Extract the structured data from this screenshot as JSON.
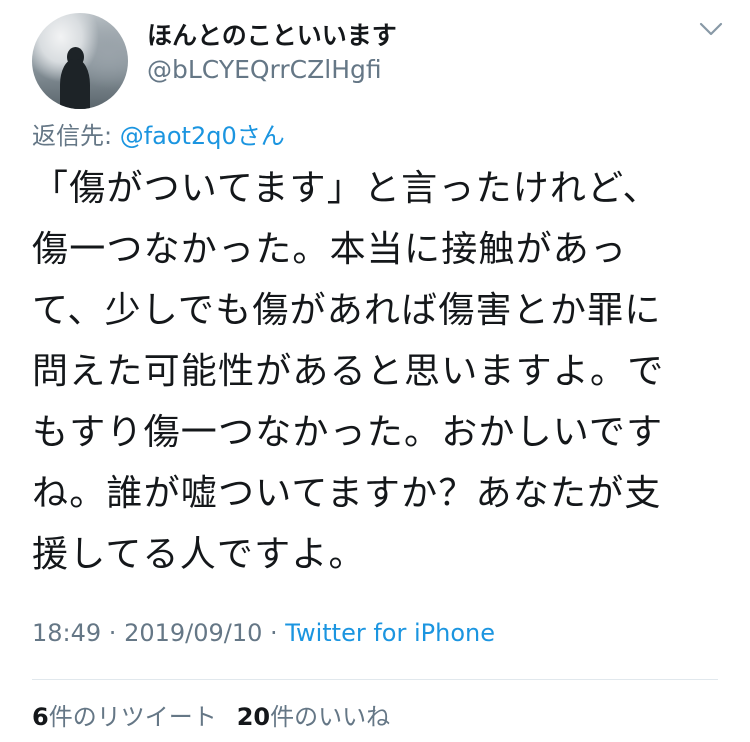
{
  "author": {
    "display_name": "ほんとのこといいます",
    "handle": "@bLCYEQrrCZlHgfi"
  },
  "reply": {
    "prefix": "返信先: ",
    "mention": "@faot2q0",
    "suffix": "さん"
  },
  "tweet": {
    "lines": [
      "「傷がついてます」と言ったけれど、",
      "傷一つなかった。本当に接触があっ",
      "て、少しでも傷があれば傷害とか罪に",
      "問えた可能性があると思いますよ。で",
      "もすり傷一つなかった。おかしいです",
      "ね。誰が嘘ついてますか？あなたが支",
      "援してる人ですよ。"
    ]
  },
  "meta": {
    "time": "18:49",
    "separator": " · ",
    "date": "2019/09/10",
    "source": "Twitter for iPhone"
  },
  "stats": {
    "retweets_count": "6",
    "retweets_label": "件のリツイート",
    "likes_count": "20",
    "likes_label": "件のいいね"
  },
  "icons": {
    "menu": "chevron-down-icon"
  },
  "colors": {
    "text": "#14171a",
    "secondary": "#657786",
    "link": "#1b95e0",
    "divider": "#e1e8ed"
  }
}
